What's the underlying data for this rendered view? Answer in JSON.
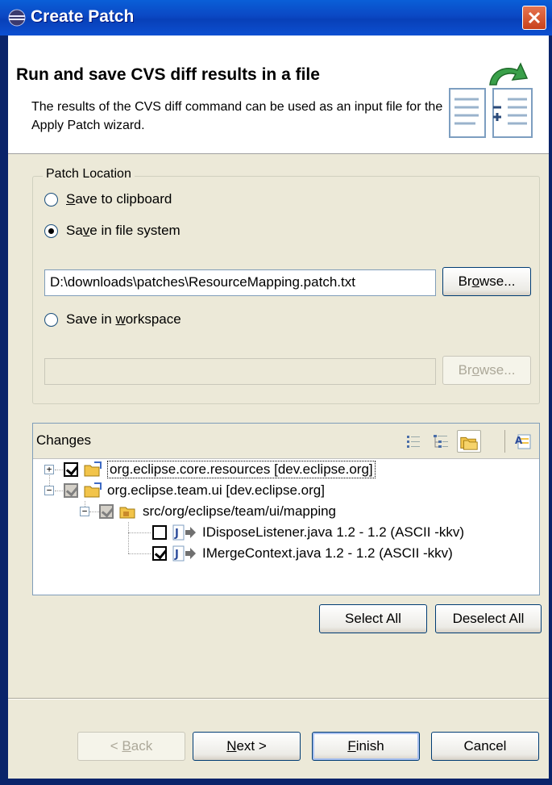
{
  "window": {
    "title": "Create Patch"
  },
  "banner": {
    "title": "Run and save CVS diff results in a file",
    "description": "The results of the CVS diff command can be used as an input file for the Apply Patch wizard."
  },
  "patch_location": {
    "group_label": "Patch Location",
    "clipboard": {
      "pre": "",
      "mn": "S",
      "post": "ave to clipboard",
      "checked": false
    },
    "filesystem": {
      "pre": "Sa",
      "mn": "v",
      "post": "e in file system",
      "checked": true
    },
    "file_path": "D:\\downloads\\patches\\ResourceMapping.patch.txt",
    "browse1": {
      "pre": "Br",
      "mn": "o",
      "post": "wse..."
    },
    "workspace": {
      "pre": "Save in ",
      "mn": "w",
      "post": "orkspace",
      "checked": false
    },
    "workspace_path": "",
    "browse2": {
      "pre": "Br",
      "mn": "o",
      "post": "wse..."
    }
  },
  "changes": {
    "label": "Changes",
    "tree": [
      {
        "label": "org.eclipse.core.resources  [dev.eclipse.org]",
        "expander": "+",
        "checked": true,
        "grey": false
      },
      {
        "label": "org.eclipse.team.ui  [dev.eclipse.org]",
        "expander": "−",
        "checked": true,
        "grey": true
      },
      {
        "label": "src/org/eclipse/team/ui/mapping",
        "expander": "−",
        "checked": true,
        "grey": true
      },
      {
        "label": "IDisposeListener.java  1.2 - 1.2  (ASCII -kkv)",
        "checked": false,
        "grey": false
      },
      {
        "label": "IMergeContext.java  1.2 - 1.2  (ASCII -kkv)",
        "checked": true,
        "grey": false
      }
    ],
    "select_all": "Select All",
    "deselect_all": "Deselect All"
  },
  "buttons": {
    "back": {
      "pre": "< ",
      "mn": "B",
      "post": "ack"
    },
    "next": {
      "pre": "",
      "mn": "N",
      "post": "ext >"
    },
    "finish": {
      "pre": "",
      "mn": "F",
      "post": "inish"
    },
    "cancel": "Cancel"
  },
  "colors": {
    "titlebar": "#0b48c4",
    "dialog_bg": "#ece9d8",
    "selection_frame": "#7f9db9"
  }
}
